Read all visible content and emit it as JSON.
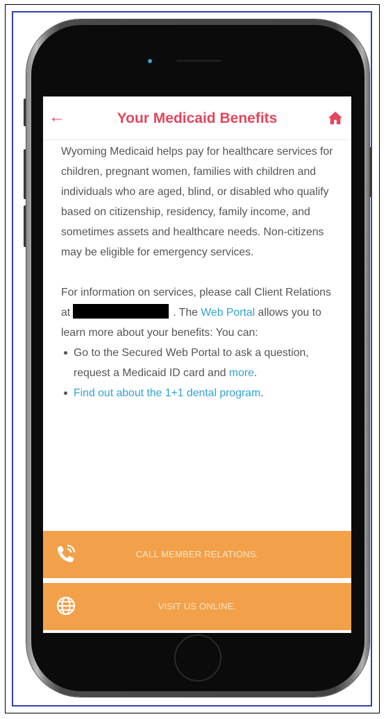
{
  "header": {
    "title": "Your Medicaid Benefits",
    "back_icon": "arrow-left-icon",
    "home_icon": "home-icon",
    "accent_color": "#e2475d"
  },
  "content": {
    "paragraph1": "Wyoming Medicaid helps pay for healthcare services for children, pregnant women, families with children and individuals who are aged, blind, or disabled who qualify based on citizenship, residency, family income, and sometimes assets and healthcare needs. Non-citizens may be eligible for emergency services.",
    "paragraph2_prefix": "For information on services, please call Client Relations at",
    "paragraph2_mid": ". The",
    "web_portal_link": "Web Portal",
    "paragraph2_suffix": "allows you to learn more about your benefits: You can:",
    "bullet1_text": "Go to the Secured Web Portal to ask a question, request a Medicaid ID card and",
    "bullet1_link": "more",
    "bullet1_end": ".",
    "bullet2_link": "Find out about the 1+1 dental program",
    "bullet2_end": ".",
    "link_color": "#31a3d0"
  },
  "actions": {
    "call_label": "CALL MEMBER RELATIONS.",
    "call_icon": "phone-icon",
    "visit_label": "VISIT US ONLINE.",
    "visit_icon": "globe-icon",
    "button_color": "#f2a14a"
  }
}
